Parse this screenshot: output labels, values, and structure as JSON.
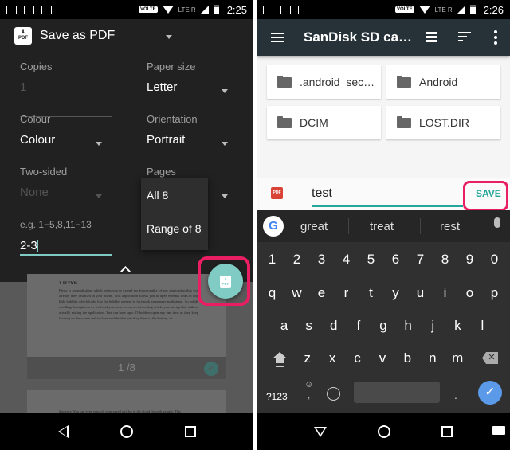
{
  "left": {
    "status": {
      "time": "2:25",
      "volte": "VOLTE",
      "lte": "LTE R"
    },
    "printer": {
      "name": "Save as PDF",
      "badge": "PDF"
    },
    "fields": {
      "copies": {
        "label": "Copies",
        "value": "1"
      },
      "paper_size": {
        "label": "Paper size",
        "value": "Letter"
      },
      "colour": {
        "label": "Colour",
        "value": "Colour"
      },
      "orientation": {
        "label": "Orientation",
        "value": "Portrait"
      },
      "two_sided": {
        "label": "Two-sided",
        "value": "None"
      },
      "pages": {
        "label": "Pages"
      }
    },
    "pages_menu": [
      "All 8",
      "Range of 8"
    ],
    "range": {
      "hint": "e.g. 1−5,8,11−13",
      "value": "2-3"
    },
    "preview": {
      "page1_title": "2. FLYNX:",
      "page1_text": "Flynx is an application which helps you to extend the functionality of any application that you already have installed in your phone. This application allows you to open external links in tiny little bubbles which looks like the bubbles present in facebook messenger application. So, while scrolling through a news feed and you come across an interesting article you can tap that without actually exiting the application. You can have upto 15 bubbles open any one time as they keep floating on the screen and to close each bubble just drag them to the bottom, its",
      "page_indicator": "1 /8",
      "page2_text": "that easy. You can even sync all your saved articles to the cloud through google. This"
    },
    "fab": {
      "label": "PDF",
      "accent": "#80cbc4",
      "highlight": "#e91e63"
    }
  },
  "right": {
    "status": {
      "time": "2:26",
      "volte": "VOLTE",
      "lte": "LTE R"
    },
    "appbar": {
      "title": "SanDisk SD ca…"
    },
    "folders": [
      ".android_sec…",
      "Android",
      "DCIM",
      "LOST.DIR"
    ],
    "save_bar": {
      "icon": "PDF",
      "filename": "test",
      "save_label": "SAVE",
      "accent": "#26a69a"
    },
    "keyboard": {
      "suggestions": [
        "great",
        "treat",
        "rest"
      ],
      "row_numbers": [
        "1",
        "2",
        "3",
        "4",
        "5",
        "6",
        "7",
        "8",
        "9",
        "0"
      ],
      "row1": [
        "q",
        "w",
        "e",
        "r",
        "t",
        "y",
        "u",
        "i",
        "o",
        "p"
      ],
      "row2": [
        "a",
        "s",
        "d",
        "f",
        "g",
        "h",
        "j",
        "k",
        "l"
      ],
      "row3": [
        "z",
        "x",
        "c",
        "v",
        "b",
        "n",
        "m"
      ],
      "symbols_key": "?123",
      "comma": ",",
      "emoji": "☺",
      "period": ".",
      "enter": "✓",
      "backspace": "✕",
      "google": "G"
    }
  }
}
